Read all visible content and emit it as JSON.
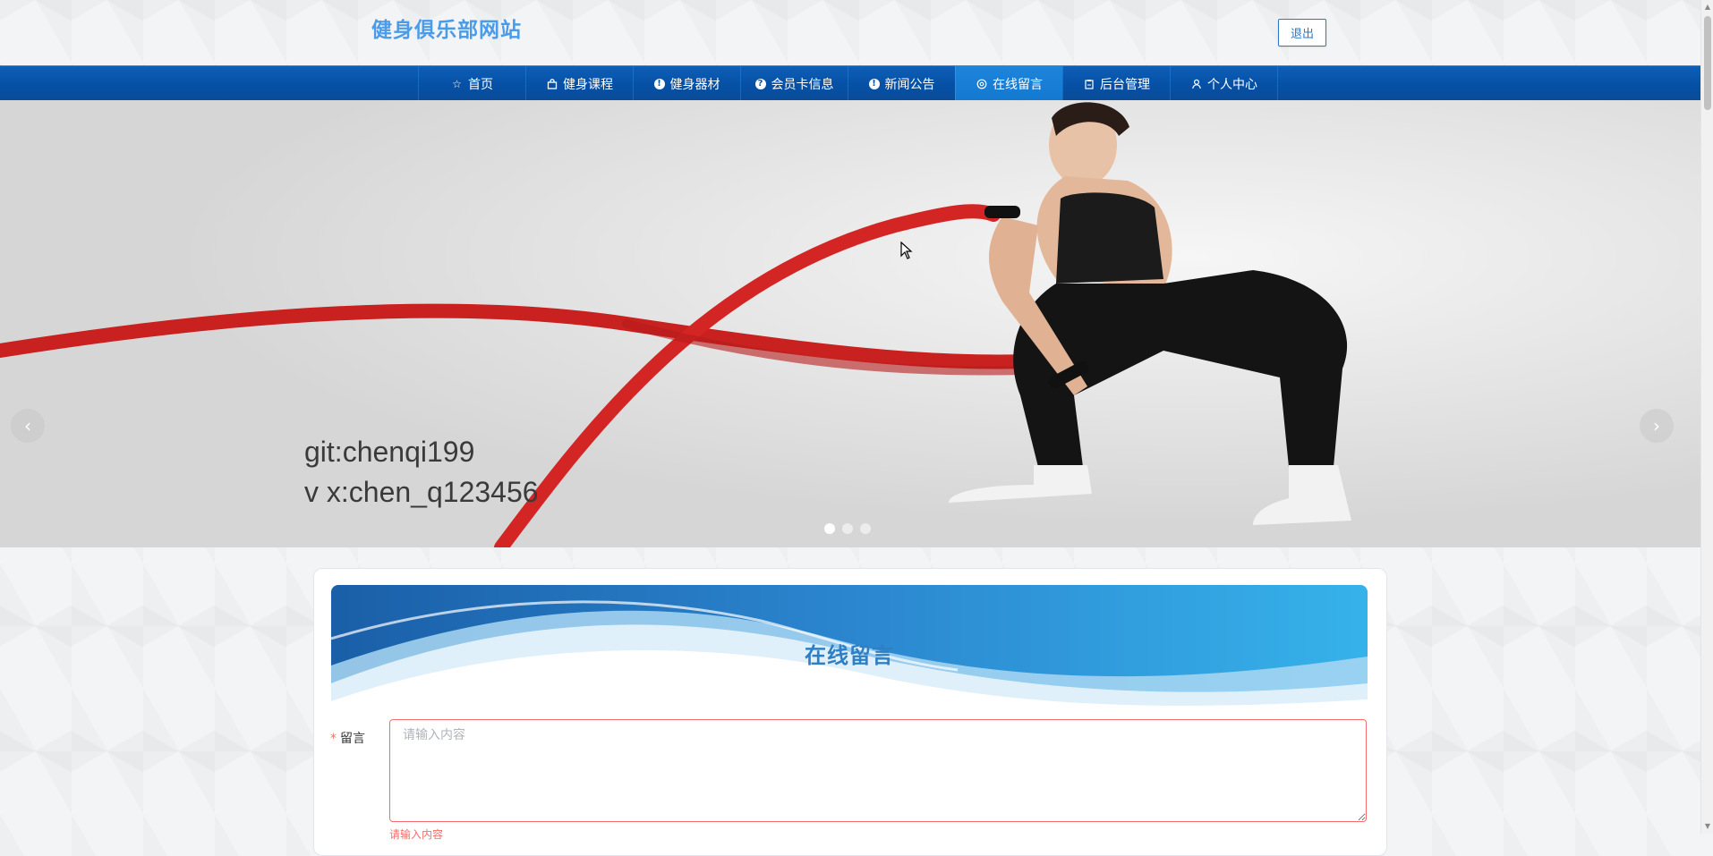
{
  "header": {
    "site_title": "健身俱乐部网站",
    "logout_label": "退出"
  },
  "nav": {
    "items": [
      {
        "label": "首页",
        "icon": "star-icon"
      },
      {
        "label": "健身课程",
        "icon": "bag-icon"
      },
      {
        "label": "健身器材",
        "icon": "info-icon"
      },
      {
        "label": "会员卡信息",
        "icon": "question-icon"
      },
      {
        "label": "新闻公告",
        "icon": "info-icon"
      },
      {
        "label": "在线留言",
        "icon": "chat-icon",
        "active": true
      },
      {
        "label": "后台管理",
        "icon": "clipboard-icon"
      },
      {
        "label": "个人中心",
        "icon": "user-icon"
      }
    ]
  },
  "carousel": {
    "overlay_line1": "git:chenqi199",
    "overlay_line2": "v x:chen_q123456",
    "prev_icon": "chevron-left-icon",
    "next_icon": "chevron-right-icon",
    "slide_count": 3,
    "active_slide": 1
  },
  "message_section": {
    "title": "在线留言",
    "field_label": "留言",
    "required_mark": "*",
    "placeholder": "请输入内容",
    "error_text": "请输入内容"
  },
  "colors": {
    "brand_title": "#4a9be8",
    "nav_bg": "#0650a6",
    "nav_active": "#1479cf",
    "error": "#f56c6c"
  }
}
